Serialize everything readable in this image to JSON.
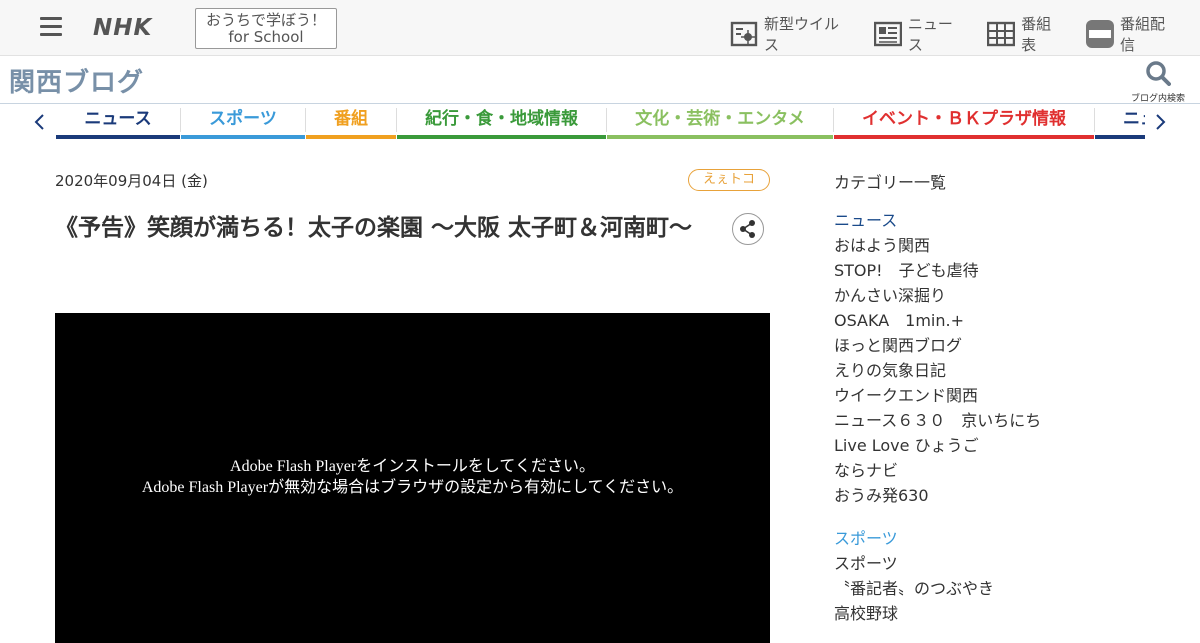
{
  "header": {
    "logo": "NHK",
    "school_line1": "おうちで学ぼう！",
    "school_line2": "for School",
    "links": [
      {
        "label": "新型ウイルス",
        "icon": "virus-info-icon"
      },
      {
        "label": "ニュース",
        "icon": "news-icon"
      },
      {
        "label": "番組表",
        "icon": "program-table-icon"
      },
      {
        "label": "番組配信",
        "icon": "nhk-plus-icon"
      }
    ]
  },
  "blog": {
    "title": "関西ブログ",
    "search_label": "ブログ内検索"
  },
  "nav": {
    "tabs": [
      {
        "label": "ニュース",
        "color": "#1a3a7a"
      },
      {
        "label": "スポーツ",
        "color": "#3a9ad9"
      },
      {
        "label": "番組",
        "color": "#f0a020"
      },
      {
        "label": "紀行・食・地域情報",
        "color": "#3a9a3a"
      },
      {
        "label": "文化・芸術・エンタメ",
        "color": "#8ac060"
      },
      {
        "label": "イベント・ＢＫプラザ情報",
        "color": "#e03030"
      },
      {
        "label": "ニュース",
        "color": "#1a3a7a"
      }
    ]
  },
  "post": {
    "date": "2020年09月04日 (金)",
    "tag": "えぇトコ",
    "title": "《予告》笑顔が満ちる！太子の楽園 ～大阪 太子町＆河南町～",
    "flash_line1": "Adobe Flash Playerをインストールをしてください。",
    "flash_line2": "Adobe Flash Playerが無効な場合はブラウザの設定から有効にしてください。"
  },
  "sidebar": {
    "heading": "カテゴリー一覧",
    "groups": [
      {
        "title": "ニュース",
        "color": "#1a4a8a",
        "items": [
          "おはよう関西",
          "STOP!　子ども虐待",
          "かんさい深掘り",
          "OSAKA　1min.+",
          "ほっと関西ブログ",
          "えりの気象日記",
          "ウイークエンド関西",
          "ニュース６３０　京いちにち",
          "Live Love ひょうご",
          "ならナビ",
          "おうみ発630"
        ]
      },
      {
        "title": "スポーツ",
        "color": "#3a9ad9",
        "items": [
          "スポーツ",
          "〝番記者〟のつぶやき",
          "高校野球"
        ]
      }
    ]
  }
}
